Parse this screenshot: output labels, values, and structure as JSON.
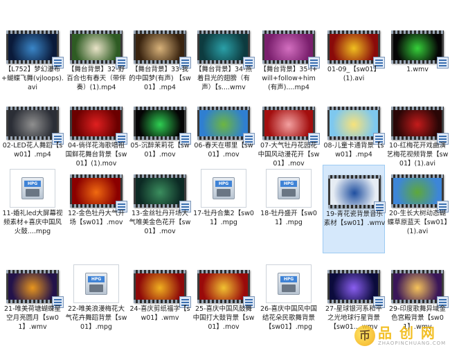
{
  "files": [
    {
      "name": "【L752】梦幻瀑布+蝴蝶飞舞(vjloops).avi",
      "kind": "video",
      "colors": [
        "#0a1a3a",
        "#3a86c8"
      ]
    },
    {
      "name": "【舞台背景】32-野百合也有春天（带伴奏）(1).mp4",
      "kind": "video",
      "colors": [
        "#2e5b23",
        "#e9e3c8"
      ]
    },
    {
      "name": "【舞台背景】33-我的中国梦(有声) 【sw01】.mp4",
      "kind": "video",
      "colors": [
        "#3a2410",
        "#d8b27a"
      ]
    },
    {
      "name": "【舞台背景】34-燕着目光的翅膀（有声）【s....wmv",
      "kind": "video",
      "colors": [
        "#0d3b3f",
        "#2aa0a8"
      ]
    },
    {
      "name": "【舞台背景】35-I+will+follow+him(有声)....mp4",
      "kind": "video",
      "colors": [
        "#7a1f6d",
        "#d36fc0"
      ]
    },
    {
      "name": "01-09_【sw01】(1).avi",
      "kind": "video",
      "colors": [
        "#8a0a0a",
        "#f0c020"
      ]
    },
    {
      "name": "1.wmv",
      "kind": "video",
      "colors": [
        "#050505",
        "#36d13a"
      ]
    },
    {
      "name": "02-LED花人舞蹈【sw01】.mp4",
      "kind": "video",
      "colors": [
        "#2b2e36",
        "#8f8f8f"
      ]
    },
    {
      "name": "04-倘徉花海歌唱祖国鲜花舞台背景【sw01】(1).mov",
      "kind": "video",
      "colors": [
        "#6b0000",
        "#e02020"
      ]
    },
    {
      "name": "05-沉醉茉莉花【sw01】.mov",
      "kind": "video",
      "colors": [
        "#050505",
        "#2ecf52"
      ]
    },
    {
      "name": "06-春天在哪里【sw01】.mov",
      "kind": "video",
      "colors": [
        "#2f7fd1",
        "#6db640"
      ]
    },
    {
      "name": "07-大气牡丹花园花中国风动漫花开【sw01】.mov",
      "kind": "video",
      "colors": [
        "#a30f0f",
        "#f3a1a1"
      ]
    },
    {
      "name": "08-儿童卡通背景【sw01】.mp4",
      "kind": "video",
      "colors": [
        "#7ec8ef",
        "#f7e27a"
      ]
    },
    {
      "name": "10-红梅花开戏曲演艺梅花视频背景【sw01】(1).avi",
      "kind": "video",
      "colors": [
        "#2a0606",
        "#c41b1b"
      ]
    },
    {
      "name": "11-婚礼led大屏幕视频素材+喜庆中国风火鼓....mpg",
      "kind": "doc",
      "colors": [
        "#ffffff",
        "#ffffff"
      ]
    },
    {
      "name": "12-金色牡丹大气开场【sw01】.mov",
      "kind": "video",
      "colors": [
        "#8b0000",
        "#f06a10"
      ]
    },
    {
      "name": "13-金丝牡丹开场大气唯美金色花开【sw01】.mov",
      "kind": "video",
      "colors": [
        "#0c2a24",
        "#3b8e5e"
      ]
    },
    {
      "name": "17-牡丹合集2【sw01】.mpg",
      "kind": "doc",
      "colors": [
        "#ffffff",
        "#ffffff"
      ]
    },
    {
      "name": "18-牡丹盛开【sw01】.mpg",
      "kind": "doc",
      "colors": [
        "#ffffff",
        "#ffffff"
      ]
    },
    {
      "name": "19-青花瓷背景音乐素材【sw01】.wmv",
      "kind": "video",
      "colors": [
        "#e6ecf3",
        "#1f4fa0"
      ]
    },
    {
      "name": "20-生长大树动态蝴蝶草原蓝天【sw01】(1).avi",
      "kind": "video",
      "colors": [
        "#3d86d8",
        "#5ea83a"
      ]
    },
    {
      "name": "21-唯美荷塘蝴蝶星空月亮圆月【sw01】.wmv",
      "kind": "video",
      "colors": [
        "#23124a",
        "#e8961e"
      ]
    },
    {
      "name": "22-唯美浪漫梅花大气花卉舞蹈背景【sw01】.mpg",
      "kind": "doc",
      "colors": [
        "#ffffff",
        "#ffffff"
      ]
    },
    {
      "name": "24-喜庆剪纸福字【sw01】.wmv",
      "kind": "video",
      "colors": [
        "#8e0909",
        "#f0b020"
      ]
    },
    {
      "name": "25-喜庆中国风鼓舞中国打大鼓背景【sw01】.mov",
      "kind": "video",
      "colors": [
        "#9a0a0a",
        "#f1c232"
      ]
    },
    {
      "name": "26-喜庆中国风中国结花朵民歌舞背景【sw01】.mpg",
      "kind": "doc",
      "colors": [
        "#ffffff",
        "#ffffff"
      ]
    },
    {
      "name": "27-星球银河系和平之光地球行星背景【sw01....wmv",
      "kind": "video",
      "colors": [
        "#0b0b3c",
        "#8a5ef0"
      ]
    },
    {
      "name": "29-印度歌舞异域金色宫殿背景【sw01】.wmv",
      "kind": "video",
      "colors": [
        "#3a1658",
        "#f6c35a"
      ]
    }
  ],
  "selected_index": 19,
  "doc_icon_tag": "HPG",
  "watermark": {
    "logo": "币",
    "big": "品 创 网",
    "small": "ZHAOPINCHUANG.COM"
  }
}
